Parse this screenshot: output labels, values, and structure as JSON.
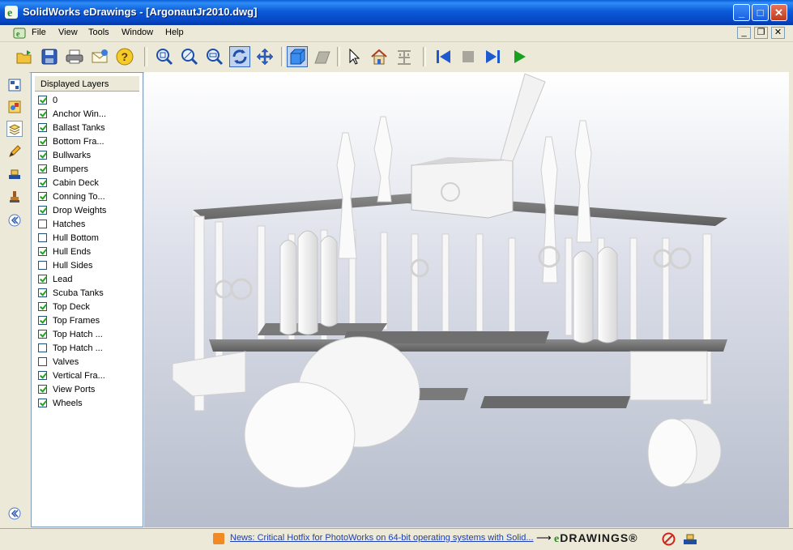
{
  "window": {
    "title": "SolidWorks eDrawings - [ArgonautJr2010.dwg]",
    "caption_buttons": {
      "minimize": "_",
      "maximize": "□",
      "close": "✕"
    },
    "mdi_buttons": {
      "minimize": "_",
      "restore": "❐",
      "close": "✕"
    }
  },
  "menu": [
    "File",
    "View",
    "Tools",
    "Window",
    "Help"
  ],
  "toolbar": {
    "icons": [
      "open-icon",
      "save-icon",
      "print-icon",
      "email-icon",
      "help-icon",
      "zoom-to-fit-icon",
      "zoom-in-out-icon",
      "zoom-to-area-icon",
      "rotate-icon",
      "pan-icon",
      "shaded-icon",
      "perspective-icon",
      "select-icon",
      "home-icon",
      "markup-icon",
      "previous-icon",
      "stop-icon",
      "next-icon",
      "play-icon"
    ]
  },
  "left_strip": {
    "icons": [
      "sheets-icon",
      "components-icon",
      "layers-icon",
      "markup-pencil-icon",
      "measure-icon",
      "stamp-icon",
      "collapse-icon",
      "expand-icon"
    ]
  },
  "layers_panel": {
    "title": "Displayed Layers",
    "layers": [
      {
        "label": "0",
        "checked": true
      },
      {
        "label": "Anchor Win...",
        "checked": true
      },
      {
        "label": "Ballast Tanks",
        "checked": true
      },
      {
        "label": "Bottom Fra...",
        "checked": true
      },
      {
        "label": "Bullwarks",
        "checked": true
      },
      {
        "label": "Bumpers",
        "checked": true
      },
      {
        "label": "Cabin Deck",
        "checked": true
      },
      {
        "label": "Conning To...",
        "checked": true
      },
      {
        "label": "Drop Weights",
        "checked": true
      },
      {
        "label": "Hatches",
        "checked": false
      },
      {
        "label": "Hull Bottom",
        "checked": false
      },
      {
        "label": "Hull Ends",
        "checked": true
      },
      {
        "label": "Hull Sides",
        "checked": false
      },
      {
        "label": "Lead",
        "checked": true
      },
      {
        "label": "Scuba Tanks",
        "checked": true
      },
      {
        "label": "Top Deck",
        "checked": true
      },
      {
        "label": "Top Frames",
        "checked": true
      },
      {
        "label": "Top Hatch ...",
        "checked": true
      },
      {
        "label": "Top Hatch ...",
        "checked": false
      },
      {
        "label": "Valves",
        "checked": false
      },
      {
        "label": "Vertical Fra...",
        "checked": true
      },
      {
        "label": "View Ports",
        "checked": true
      },
      {
        "label": "Wheels",
        "checked": true
      }
    ]
  },
  "status": {
    "news": "News: Critical Hotfix for PhotoWorks on 64-bit operating systems with Solid...",
    "logo": "DRAWINGS®",
    "logo_prefix": "e"
  },
  "colors": {
    "titlebar": "#0a5ad8",
    "chrome": "#ece9d8",
    "viewport_bottom": "#b7bdcc",
    "model": "#f4f4f4"
  }
}
